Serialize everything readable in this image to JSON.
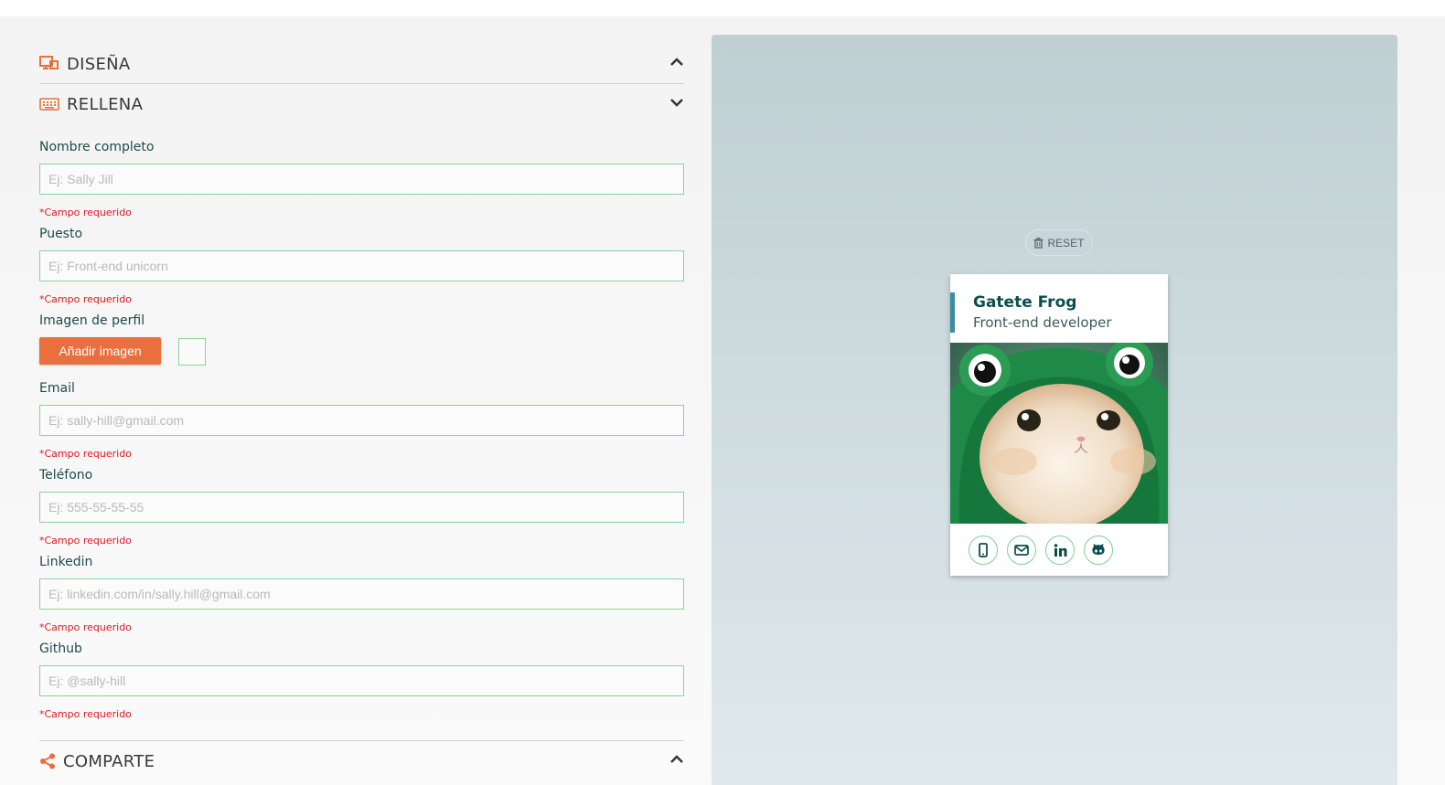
{
  "sections": {
    "design": {
      "title": "DISEÑA"
    },
    "fill": {
      "title": "RELLENA"
    },
    "share": {
      "title": "COMPARTE"
    }
  },
  "form": {
    "required_text": "*Campo requerido",
    "name": {
      "label": "Nombre completo",
      "placeholder": "Ej: Sally Jill",
      "value": ""
    },
    "job": {
      "label": "Puesto",
      "placeholder": "Ej: Front-end unicorn",
      "value": ""
    },
    "image": {
      "label": "Imagen de perfil",
      "button": "Añadir imagen"
    },
    "email": {
      "label": "Email",
      "placeholder": "Ej: sally-hill@gmail.com",
      "value": ""
    },
    "phone": {
      "label": "Teléfono",
      "placeholder": "Ej: 555-55-55-55",
      "value": ""
    },
    "linkedin": {
      "label": "Linkedin",
      "placeholder": "Ej: linkedin.com/in/sally.hill@gmail.com",
      "value": ""
    },
    "github": {
      "label": "Github",
      "placeholder": "Ej: @sally-hill",
      "value": ""
    }
  },
  "preview": {
    "reset_label": "RESET",
    "card": {
      "name": "Gatete Frog",
      "job": "Front-end developer",
      "icons": [
        "mobile-icon",
        "envelope-icon",
        "linkedin-icon",
        "github-icon"
      ]
    }
  },
  "colors": {
    "accent": "#e96f3e",
    "field_border": "#8bd39a",
    "required": "#e0171f",
    "card_name": "#0b4d4d",
    "card_bar": "#3b8ea0"
  }
}
